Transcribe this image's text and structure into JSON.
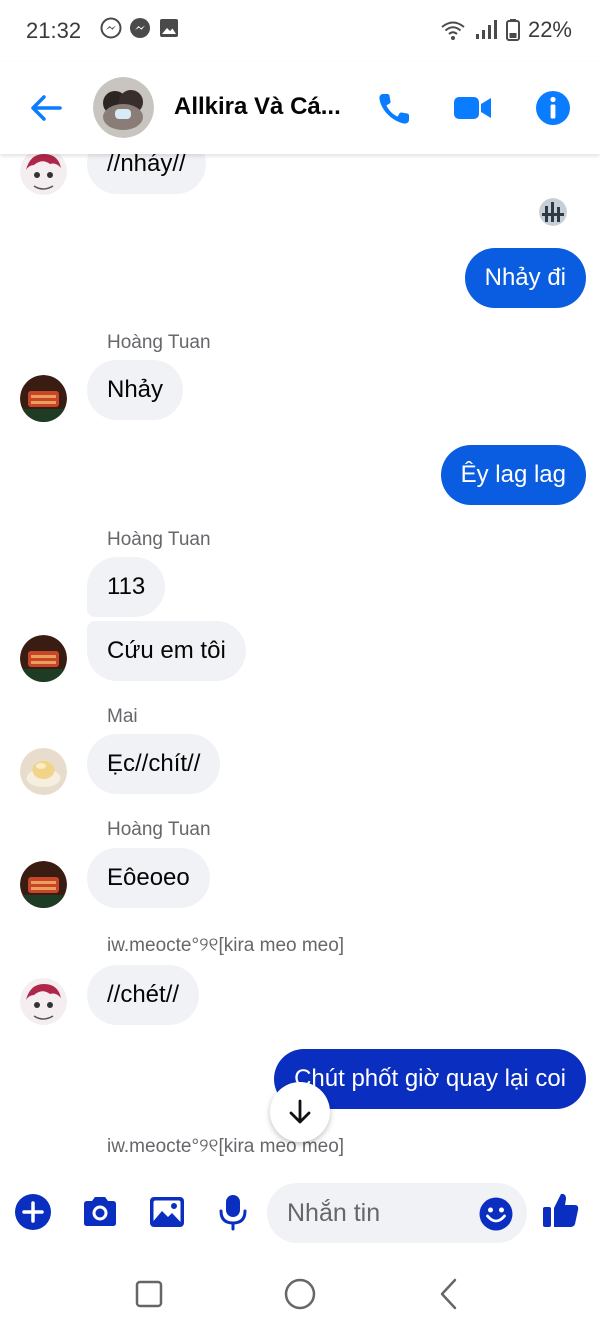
{
  "status_bar": {
    "time": "21:32",
    "battery": "22%",
    "app_icons": [
      "messenger-icon",
      "messenger-icon",
      "gallery-icon"
    ]
  },
  "header": {
    "title": "Allkira Và Cá...",
    "actions": [
      "phone-icon",
      "video-call-icon",
      "info-icon"
    ]
  },
  "messages": [
    {
      "type": "in",
      "text": "//nháy//"
    },
    {
      "type": "out",
      "text": "Nhảy đi"
    },
    {
      "type": "in",
      "sender": "Hoàng Tuan",
      "text": "Nhảy"
    },
    {
      "type": "out",
      "text": "Êy lag lag"
    },
    {
      "type": "in",
      "sender": "Hoàng Tuan",
      "text": "113"
    },
    {
      "type": "in",
      "text": "Cứu em tôi"
    },
    {
      "type": "in",
      "sender": "Mai",
      "text": "Ẹc//chít//"
    },
    {
      "type": "in",
      "sender": "Hoàng Tuan",
      "text": "Eôeoeo"
    },
    {
      "type": "in",
      "sender": "iw.meocte°୨୧[kira meo meo]",
      "text": "//chét//"
    },
    {
      "type": "out",
      "text": "Chút phốt giờ quay lại coi"
    },
    {
      "type": "sender_only",
      "sender": "iw.meocte°୨୧[kira meo meo]"
    }
  ],
  "composer": {
    "placeholder": "Nhắn tin"
  },
  "colors": {
    "accent": "#0a7cff",
    "outgoing_bubble": "#0a5ce0",
    "outgoing_bubble_dark": "#0a2fc0",
    "incoming_bubble": "#f0f2f5",
    "meta_text": "#65676b"
  }
}
